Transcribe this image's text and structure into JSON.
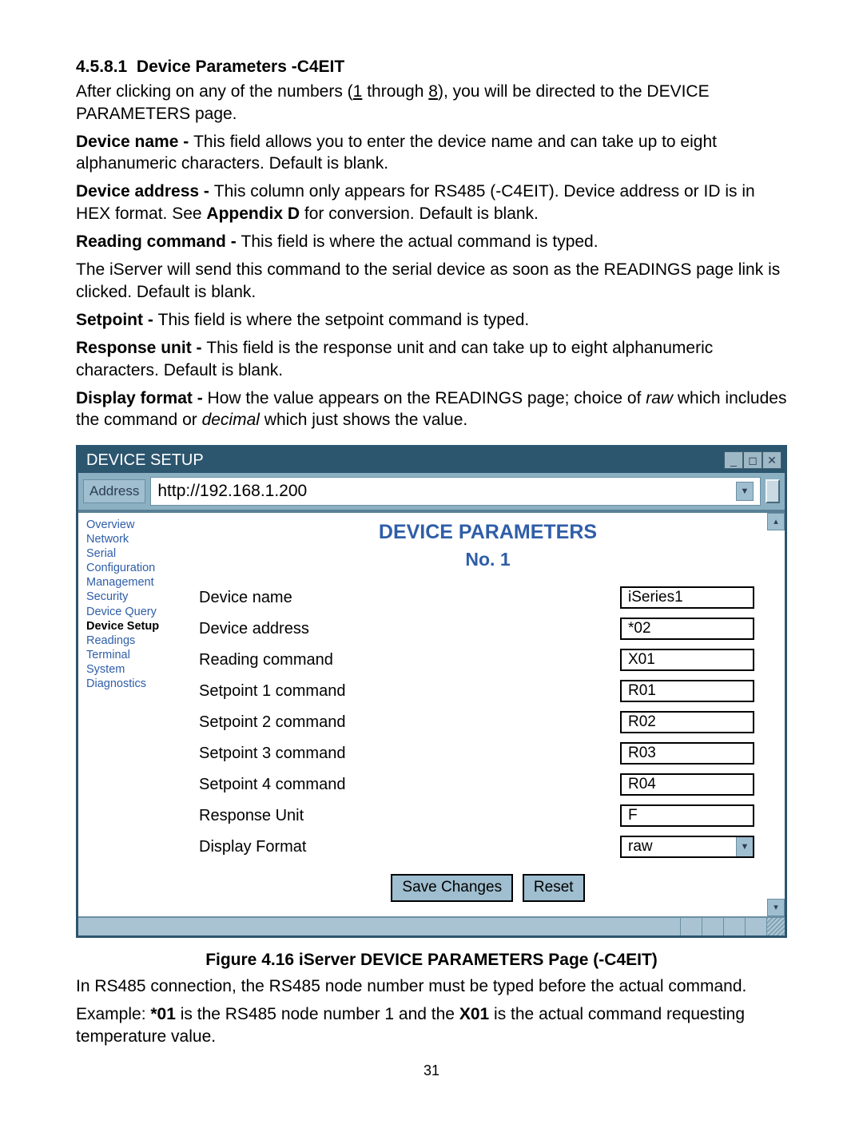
{
  "section": {
    "number": "4.5.8.1",
    "title": "Device Parameters -C4EIT",
    "intro_a": "After clicking on any of the numbers (",
    "intro_num1": "1",
    "intro_b": " through ",
    "intro_num2": "8",
    "intro_c": "), you will be directed to the DEVICE PARAMETERS page.",
    "device_name_label": "Device name - ",
    "device_name_text": "This field allows you to enter the device name and can take up to eight alphanumeric characters. Default is blank.",
    "device_addr_label": "Device address - ",
    "device_addr_text_a": "This column only appears for RS485 (-C4EIT). Device address or ID is in HEX format. See ",
    "device_addr_bold": "Appendix D",
    "device_addr_text_b": " for conversion. Default is blank.",
    "reading_cmd_label": "Reading command - ",
    "reading_cmd_text": "This field is where the actual command is typed.",
    "iserver_text": "The iServer will send this command to the serial device as soon as the READINGS page link is clicked. Default is blank.",
    "setpoint_label": "Setpoint - ",
    "setpoint_text": "This field is where the setpoint command is typed.",
    "response_label": "Response unit - ",
    "response_text": "This field is the response unit and can take up to eight alphanumeric characters. Default is blank.",
    "display_label": "Display format - ",
    "display_text_a": "How the value appears on the READINGS page; choice of ",
    "display_italic1": "raw",
    "display_text_b": " which includes the command or ",
    "display_italic2": "decimal",
    "display_text_c": " which just shows the value."
  },
  "window": {
    "title": "DEVICE SETUP",
    "address_label": "Address",
    "address_value": "http://192.168.1.200",
    "sidebar": [
      "Overview",
      "Network",
      "Serial",
      "Configuration",
      "Management",
      "Security",
      "Device Query",
      "Device Setup",
      "Readings",
      "Terminal",
      "System",
      "Diagnostics"
    ],
    "sidebar_active_index": 7,
    "page_title": "DEVICE PARAMETERS",
    "page_subtitle": "No. 1",
    "fields": [
      {
        "label": "Device name",
        "value": "iSeries1"
      },
      {
        "label": "Device address",
        "value": "*02"
      },
      {
        "label": "Reading command",
        "value": "X01"
      },
      {
        "label": "Setpoint 1 command",
        "value": "R01"
      },
      {
        "label": "Setpoint 2 command",
        "value": "R02"
      },
      {
        "label": "Setpoint 3 command",
        "value": "R03"
      },
      {
        "label": "Setpoint 4 command",
        "value": "R04"
      },
      {
        "label": "Response Unit",
        "value": "F"
      }
    ],
    "display_format_label": "Display Format",
    "display_format_value": "raw",
    "save_button": "Save Changes",
    "reset_button": "Reset"
  },
  "figure": {
    "caption": "Figure 4.16  iServer DEVICE PARAMETERS Page (-C4EIT)",
    "note1": "In RS485 connection, the RS485 node number must be typed before the actual command.",
    "note2_a": "Example: ",
    "note2_bold1": "*01",
    "note2_b": " is the RS485 node number 1 and the ",
    "note2_bold2": "X01",
    "note2_c": " is the actual command requesting temperature value."
  },
  "page_number": "31"
}
